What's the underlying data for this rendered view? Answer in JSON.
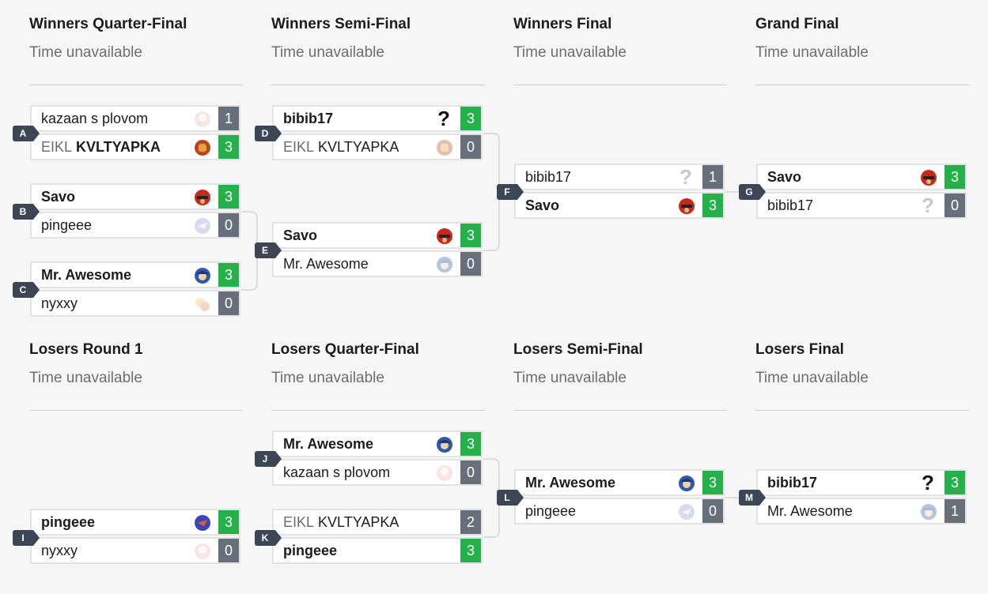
{
  "colors": {
    "win": "#26b04b",
    "lose": "#67707a",
    "tag": "#3d4655"
  },
  "rounds": {
    "wqf": {
      "title": "Winners Quarter-Final",
      "time": "Time unavailable"
    },
    "wsf": {
      "title": "Winners Semi-Final",
      "time": "Time unavailable"
    },
    "wf": {
      "title": "Winners Final",
      "time": "Time unavailable"
    },
    "gf": {
      "title": "Grand Final",
      "time": "Time unavailable"
    },
    "lr1": {
      "title": "Losers Round 1",
      "time": "Time unavailable"
    },
    "lqf": {
      "title": "Losers Quarter-Final",
      "time": "Time unavailable"
    },
    "lsf": {
      "title": "Losers Semi-Final",
      "time": "Time unavailable"
    },
    "lf": {
      "title": "Losers Final",
      "time": "Time unavailable"
    }
  },
  "matches": {
    "A": {
      "tag": "A",
      "top": {
        "prefix": "",
        "name": "kazaan s plovom",
        "score": "1",
        "icon": "pink-character-icon"
      },
      "bottom": {
        "prefix": "EIKL",
        "name": "KVLTYAPKA",
        "score": "3",
        "icon": "red-character-icon"
      }
    },
    "B": {
      "tag": "B",
      "top": {
        "prefix": "",
        "name": "Savo",
        "score": "3",
        "icon": "falcon-character-icon"
      },
      "bottom": {
        "prefix": "",
        "name": "pingeee",
        "score": "0",
        "icon": "falco-character-icon"
      }
    },
    "C": {
      "tag": "C",
      "top": {
        "prefix": "",
        "name": "Mr. Awesome",
        "score": "3",
        "icon": "marth-character-icon"
      },
      "bottom": {
        "prefix": "",
        "name": "nyxxy",
        "score": "0",
        "icon": "multi-character-icon"
      }
    },
    "D": {
      "tag": "D",
      "top": {
        "prefix": "",
        "name": "bibib17",
        "score": "3",
        "icon": "unknown-character-icon",
        "glyph": "?"
      },
      "bottom": {
        "prefix": "EIKL",
        "name": "KVLTYAPKA",
        "score": "0",
        "icon": "red-character-icon"
      }
    },
    "E": {
      "tag": "E",
      "top": {
        "prefix": "",
        "name": "Savo",
        "score": "3",
        "icon": "falcon-character-icon"
      },
      "bottom": {
        "prefix": "",
        "name": "Mr. Awesome",
        "score": "0",
        "icon": "marth-character-icon"
      }
    },
    "F": {
      "tag": "F",
      "top": {
        "prefix": "",
        "name": "bibib17",
        "score": "1",
        "icon": "unknown-character-icon",
        "glyph": "?"
      },
      "bottom": {
        "prefix": "",
        "name": "Savo",
        "score": "3",
        "icon": "falcon-character-icon"
      }
    },
    "G": {
      "tag": "G",
      "top": {
        "prefix": "",
        "name": "Savo",
        "score": "3",
        "icon": "falcon-character-icon"
      },
      "bottom": {
        "prefix": "",
        "name": "bibib17",
        "score": "0",
        "icon": "unknown-character-icon",
        "glyph": "?"
      }
    },
    "I": {
      "tag": "I",
      "top": {
        "prefix": "",
        "name": "pingeee",
        "score": "3",
        "icon": "falco-character-icon"
      },
      "bottom": {
        "prefix": "",
        "name": "nyxxy",
        "score": "0",
        "icon": "pink-character-icon"
      }
    },
    "J": {
      "tag": "J",
      "top": {
        "prefix": "",
        "name": "Mr. Awesome",
        "score": "3",
        "icon": "marth-character-icon"
      },
      "bottom": {
        "prefix": "",
        "name": "kazaan s plovom",
        "score": "0",
        "icon": "pink-character-icon"
      }
    },
    "K": {
      "tag": "K",
      "top": {
        "prefix": "EIKL",
        "name": "KVLTYAPKA",
        "score": "2",
        "icon": ""
      },
      "bottom": {
        "prefix": "",
        "name": "pingeee",
        "score": "3",
        "icon": ""
      }
    },
    "L": {
      "tag": "L",
      "top": {
        "prefix": "",
        "name": "Mr. Awesome",
        "score": "3",
        "icon": "marth-character-icon"
      },
      "bottom": {
        "prefix": "",
        "name": "pingeee",
        "score": "0",
        "icon": "falco-character-icon"
      }
    },
    "M": {
      "tag": "M",
      "top": {
        "prefix": "",
        "name": "bibib17",
        "score": "3",
        "icon": "unknown-character-icon",
        "glyph": "?"
      },
      "bottom": {
        "prefix": "",
        "name": "Mr. Awesome",
        "score": "1",
        "icon": "marth-character-icon"
      }
    }
  }
}
